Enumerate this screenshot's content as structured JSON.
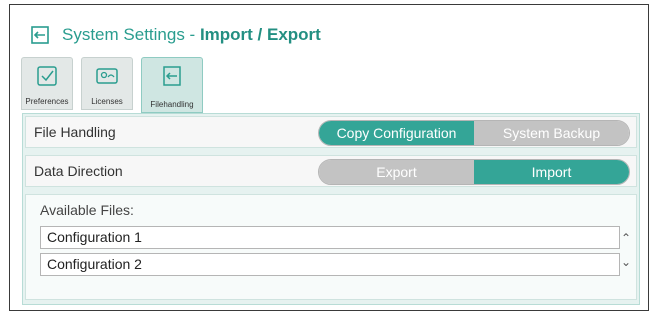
{
  "window": {
    "title_prefix": "System Settings - ",
    "title_bold": "Import / Export"
  },
  "tabs": [
    {
      "label": "Preferences",
      "icon": "checkbox-icon"
    },
    {
      "label": "Licenses",
      "icon": "license-icon"
    },
    {
      "label": "Filehandling",
      "icon": "import-icon"
    }
  ],
  "file_handling": {
    "label": "File Handling",
    "options": [
      "Copy Configuration",
      "System Backup"
    ],
    "selected": "Copy Configuration"
  },
  "data_direction": {
    "label": "Data Direction",
    "options": [
      "Export",
      "Import"
    ],
    "selected": "Import"
  },
  "available_files": {
    "label": "Available Files:",
    "items": [
      "Configuration 1",
      "Configuration 2"
    ]
  },
  "colors": {
    "accent": "#34a597",
    "inactive": "#c3c3c3",
    "panel": "#e6f2f0"
  }
}
